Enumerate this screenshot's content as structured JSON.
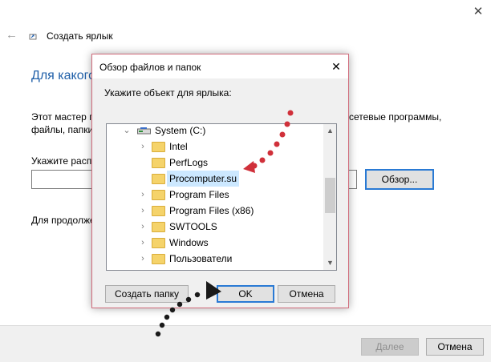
{
  "wizard": {
    "title": "Создать ярлык",
    "heading": "Для какого",
    "description_lines": [
      "Этот мастер п",
      "файлы, папки"
    ],
    "description_right": "сетевые программы,",
    "location_label": "Укажите расп",
    "location_value": "",
    "browse_label": "Обзор...",
    "continue_text": "Для продолжен",
    "next_label": "Далее",
    "cancel_label": "Отмена"
  },
  "dialog": {
    "title": "Обзор файлов и папок",
    "prompt": "Укажите объект для ярлыка:",
    "tree": [
      {
        "label": "System (C:)",
        "type": "drive",
        "expander": "expanded"
      },
      {
        "label": "Intel",
        "type": "folder",
        "expander": "collapsed"
      },
      {
        "label": "PerfLogs",
        "type": "folder",
        "expander": "none"
      },
      {
        "label": "Procomputer.su",
        "type": "folder",
        "expander": "none",
        "selected": true
      },
      {
        "label": "Program Files",
        "type": "folder",
        "expander": "collapsed"
      },
      {
        "label": "Program Files (x86)",
        "type": "folder",
        "expander": "collapsed"
      },
      {
        "label": "SWTOOLS",
        "type": "folder",
        "expander": "collapsed"
      },
      {
        "label": "Windows",
        "type": "folder",
        "expander": "collapsed"
      },
      {
        "label": "Пользователи",
        "type": "folder",
        "expander": "collapsed"
      }
    ],
    "new_folder_label": "Создать папку",
    "ok_label": "OK",
    "cancel_label": "Отмена"
  },
  "colors": {
    "accent_blue": "#2a7ad4",
    "heading_blue": "#1f5fa8",
    "selection": "#cce8ff",
    "annotation_red": "#d0303a",
    "annotation_black": "#1a1a1a"
  },
  "icons": {
    "window_close": "close-icon",
    "back": "back-arrow-icon",
    "shortcut": "shortcut-icon",
    "drive": "drive-icon",
    "folder": "folder-icon"
  }
}
